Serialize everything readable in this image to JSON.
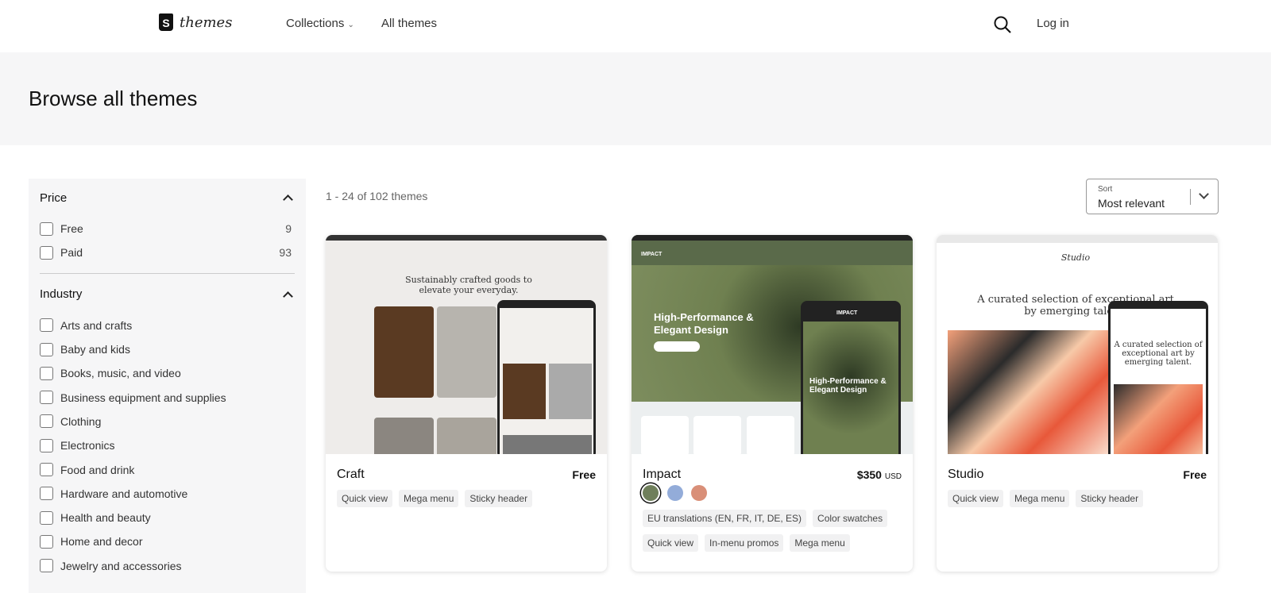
{
  "header": {
    "logo_text": "themes",
    "nav": [
      {
        "label": "Collections"
      },
      {
        "label": "All themes"
      }
    ],
    "login": "Log in"
  },
  "page_title": "Browse all themes",
  "filters": {
    "price": {
      "title": "Price",
      "options": [
        {
          "label": "Free",
          "count": "9"
        },
        {
          "label": "Paid",
          "count": "93"
        }
      ]
    },
    "industry": {
      "title": "Industry",
      "options": [
        {
          "label": "Arts and crafts"
        },
        {
          "label": "Baby and kids"
        },
        {
          "label": "Books, music, and video"
        },
        {
          "label": "Business equipment and supplies"
        },
        {
          "label": "Clothing"
        },
        {
          "label": "Electronics"
        },
        {
          "label": "Food and drink"
        },
        {
          "label": "Hardware and automotive"
        },
        {
          "label": "Health and beauty"
        },
        {
          "label": "Home and decor"
        },
        {
          "label": "Jewelry and accessories"
        }
      ]
    }
  },
  "results_count": "1 - 24 of 102 themes",
  "sort": {
    "label": "Sort",
    "value": "Most relevant"
  },
  "themes": [
    {
      "name": "Craft",
      "price": "Free",
      "tags": [
        "Quick view",
        "Mega menu",
        "Sticky header"
      ],
      "preview_headline": "Sustainably crafted goods to elevate your everyday."
    },
    {
      "name": "Impact",
      "price": "$350",
      "currency": "USD",
      "swatches": [
        "#6f7f5b",
        "#93acd9",
        "#d98f78"
      ],
      "tags_row1": [
        "EU translations (EN, FR, IT, DE, ES)",
        "Color swatches"
      ],
      "tags_row2": [
        "Quick view",
        "In-menu promos",
        "Mega menu"
      ],
      "preview_brand": "IMPACT",
      "preview_headline": "High-Performance & Elegant Design"
    },
    {
      "name": "Studio",
      "price": "Free",
      "tags": [
        "Quick view",
        "Mega menu",
        "Sticky header"
      ],
      "preview_brand": "Studio",
      "preview_headline": "A curated selection of exceptional art by emerging talent."
    }
  ]
}
